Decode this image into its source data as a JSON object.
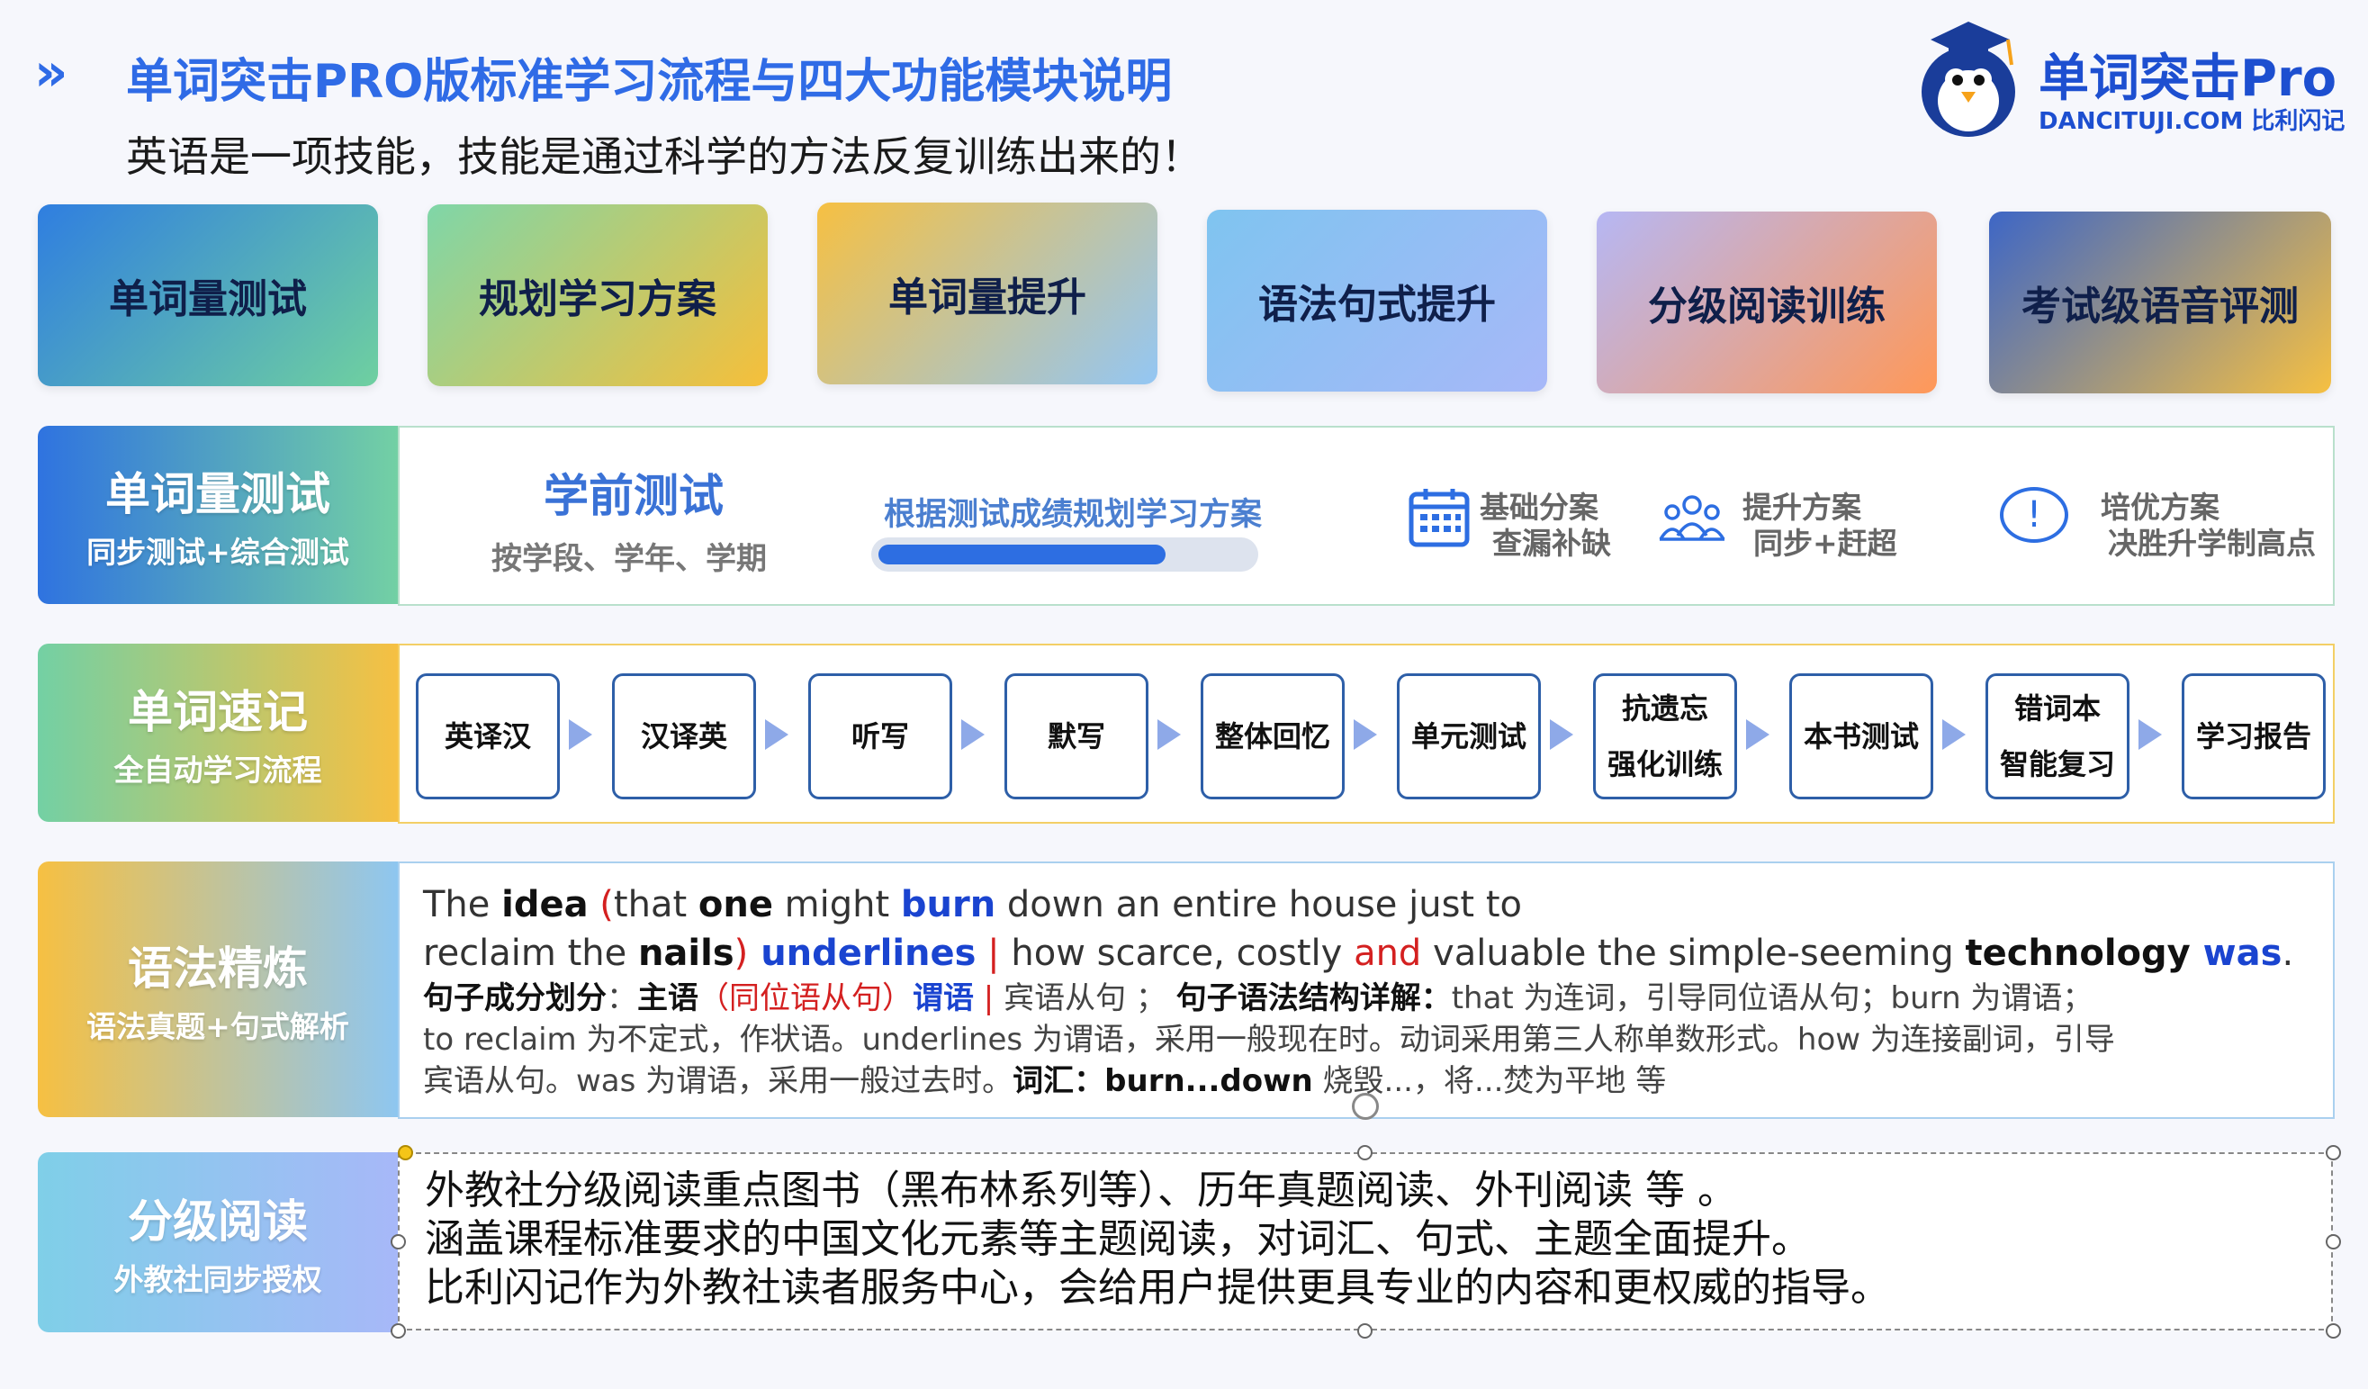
{
  "header": {
    "chevron": "»",
    "title": "单词突击PRO版标准学习流程与四大功能模块说明",
    "subtitle": "英语是一项技能，技能是通过科学的方法反复训练出来的！"
  },
  "logo": {
    "name": "单词突击Pro",
    "domain_tagline": "DANCITUJI.COM 比利闪记"
  },
  "top_cards": [
    {
      "label": "单词量测试",
      "gradient": [
        "#2f7ee0",
        "#6fd0a0"
      ]
    },
    {
      "label": "规划学习方案",
      "gradient": [
        "#7fd6a8",
        "#f6bf3a"
      ]
    },
    {
      "label": "单词量提升",
      "gradient": [
        "#f6c042",
        "#93c6f4"
      ]
    },
    {
      "label": "语法句式提升",
      "gradient": [
        "#7fc4f0",
        "#a7b8f8"
      ]
    },
    {
      "label": "分级阅读训练",
      "gradient": [
        "#b6b7f4",
        "#ff9858"
      ]
    },
    {
      "label": "考试级语音评测",
      "gradient": [
        "#3d66c6",
        "#f6c042"
      ]
    }
  ],
  "test_row": {
    "label": "单词量测试",
    "label_sub": "同步测试+综合测试",
    "pretest_title": "学前测试",
    "pretest_sub": "按学段、学年、学期",
    "plan_title": "根据测试成绩规划学习方案",
    "plan_progress": 0.77,
    "options": [
      {
        "icon": "calendar-icon",
        "line1": "基础分案",
        "line2": "查漏补缺"
      },
      {
        "icon": "people-icon",
        "line1": "提升方案",
        "line2": "同步+赶超"
      },
      {
        "icon": "alert-icon",
        "symbol": "!",
        "line1": "培优方案",
        "line2": "决胜升学制高点"
      }
    ]
  },
  "memo_row": {
    "label": "单词速记",
    "label_sub": "全自动学习流程",
    "steps": [
      {
        "line1": "英译汉",
        "line2": ""
      },
      {
        "line1": "汉译英",
        "line2": ""
      },
      {
        "line1": "听写",
        "line2": ""
      },
      {
        "line1": "默写",
        "line2": ""
      },
      {
        "line1": "整体回忆",
        "line2": ""
      },
      {
        "line1": "单元测试",
        "line2": ""
      },
      {
        "line1": "抗遗忘",
        "line2": "强化训练"
      },
      {
        "line1": "本书测试",
        "line2": ""
      },
      {
        "line1": "错词本",
        "line2": "智能复习"
      },
      {
        "line1": "学习报告",
        "line2": ""
      }
    ]
  },
  "grammar_row": {
    "label": "语法精炼",
    "label_sub": "语法真题+句式解析",
    "s1": {
      "a": "The ",
      "b": "idea",
      "c": " ",
      "d": "(",
      "e": "that ",
      "f": "one",
      "g": " might ",
      "h": "burn",
      "i": " down an entire house just to"
    },
    "s2": {
      "a": "reclaim the ",
      "b": "nails",
      "c": ")",
      "d": " underlines",
      "e": " | ",
      "f": "how scarce, costly ",
      "g": "and",
      "h": " valuable the simple-seeming ",
      "i": "technology",
      "j": " was",
      "k": "."
    },
    "p1": {
      "a": "句子成分划分",
      "b": "：",
      "c": "主语",
      "d": "（同位语从句）",
      "e": "谓语",
      "f": " | ",
      "g": "宾语从句 ； ",
      "h": "句子语法结构详解：",
      "i": "that 为连词，引导同位语从句；burn 为谓语；"
    },
    "p2": "to reclaim 为不定式，作状语。underlines 为谓语，采用一般现在时。动词采用第三人称单数形式。how 为连接副词，引导",
    "p3": {
      "a": "宾语从句。was 为谓语，采用一般过去时。",
      "b": "词汇：burn...down",
      "c": "  烧毁...，将...焚为平地  等"
    }
  },
  "reading_row": {
    "label": "分级阅读",
    "label_sub": "外教社同步授权",
    "lines": [
      "外教社分级阅读重点图书（黑布林系列等）、历年真题阅读、外刊阅读 等 。",
      "涵盖课程标准要求的中国文化元素等主题阅读，对词汇、句式、主题全面提升。",
      "比利闪记作为外教社读者服务中心，会给用户提供更具专业的内容和更权威的指导。"
    ]
  }
}
